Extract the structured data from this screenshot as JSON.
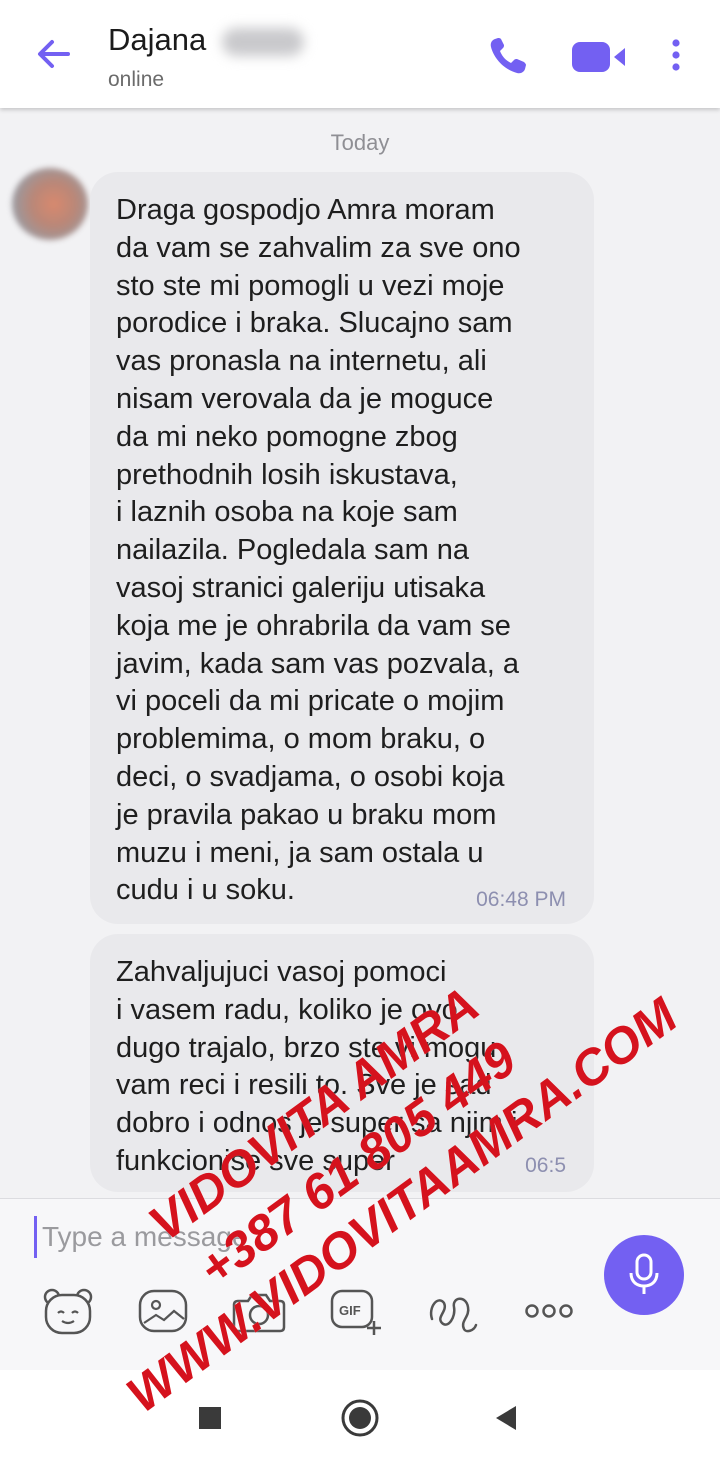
{
  "header": {
    "contact_name": "Dajana",
    "status": "online"
  },
  "chat": {
    "day_label": "Today",
    "messages": [
      {
        "text": "Draga gospodjo Amra moram\nda vam se zahvalim za sve ono\nsto ste mi pomogli u vezi moje\nporodice i braka. Slucajno sam\nvas pronasla na internetu, ali\nnisam verovala da je moguce\nda mi neko pomogne zbog\nprethodnih losih iskustava,\ni laznih osoba na koje sam\nnailazila. Pogledala sam na\nvasoj stranici galeriju utisaka\nkoja me je ohrabrila da vam se\njavim, kada sam vas pozvala, a\nvi poceli da mi pricate o mojim\nproblemima, o mom braku, o\ndeci, o svadjama, o osobi koja\nje pravila pakao u braku mom\nmuzu i meni, ja sam ostala u\ncudu i u soku.",
        "time": "06:48 PM"
      },
      {
        "text": "Zahvaljujuci vasoj pomoci\ni vasem radu, koliko je ovo\ndugo trajalo, brzo ste vi mogu\nvam reci i resili to. Sve je sad\ndobro i odnos je super sa njim i\nfunkcionise sve super",
        "time": "06:5"
      }
    ]
  },
  "composer": {
    "placeholder": "Type a message"
  },
  "icons": {
    "back": "back-arrow-icon",
    "call": "phone-icon",
    "video": "video-camera-icon",
    "menu": "more-vertical-icon",
    "mic": "microphone-icon",
    "tools": [
      "sticker-bear-icon",
      "gallery-icon",
      "camera-icon",
      "gif-icon",
      "doodle-icon",
      "more-horizontal-icon"
    ],
    "nav": [
      "recents-square-icon",
      "home-circle-icon",
      "back-triangle-icon"
    ]
  },
  "watermark": {
    "line1": "VIDOVITA AMRA",
    "line2": "+387 61 805 449",
    "line3": "WWW.VIDOVITAAMRA.COM"
  },
  "colors": {
    "accent": "#7360f2",
    "bubble": "#e9e9ec",
    "background": "#f2f2f4",
    "watermark": "#d5121d",
    "timestamp": "#8d8fb0"
  }
}
